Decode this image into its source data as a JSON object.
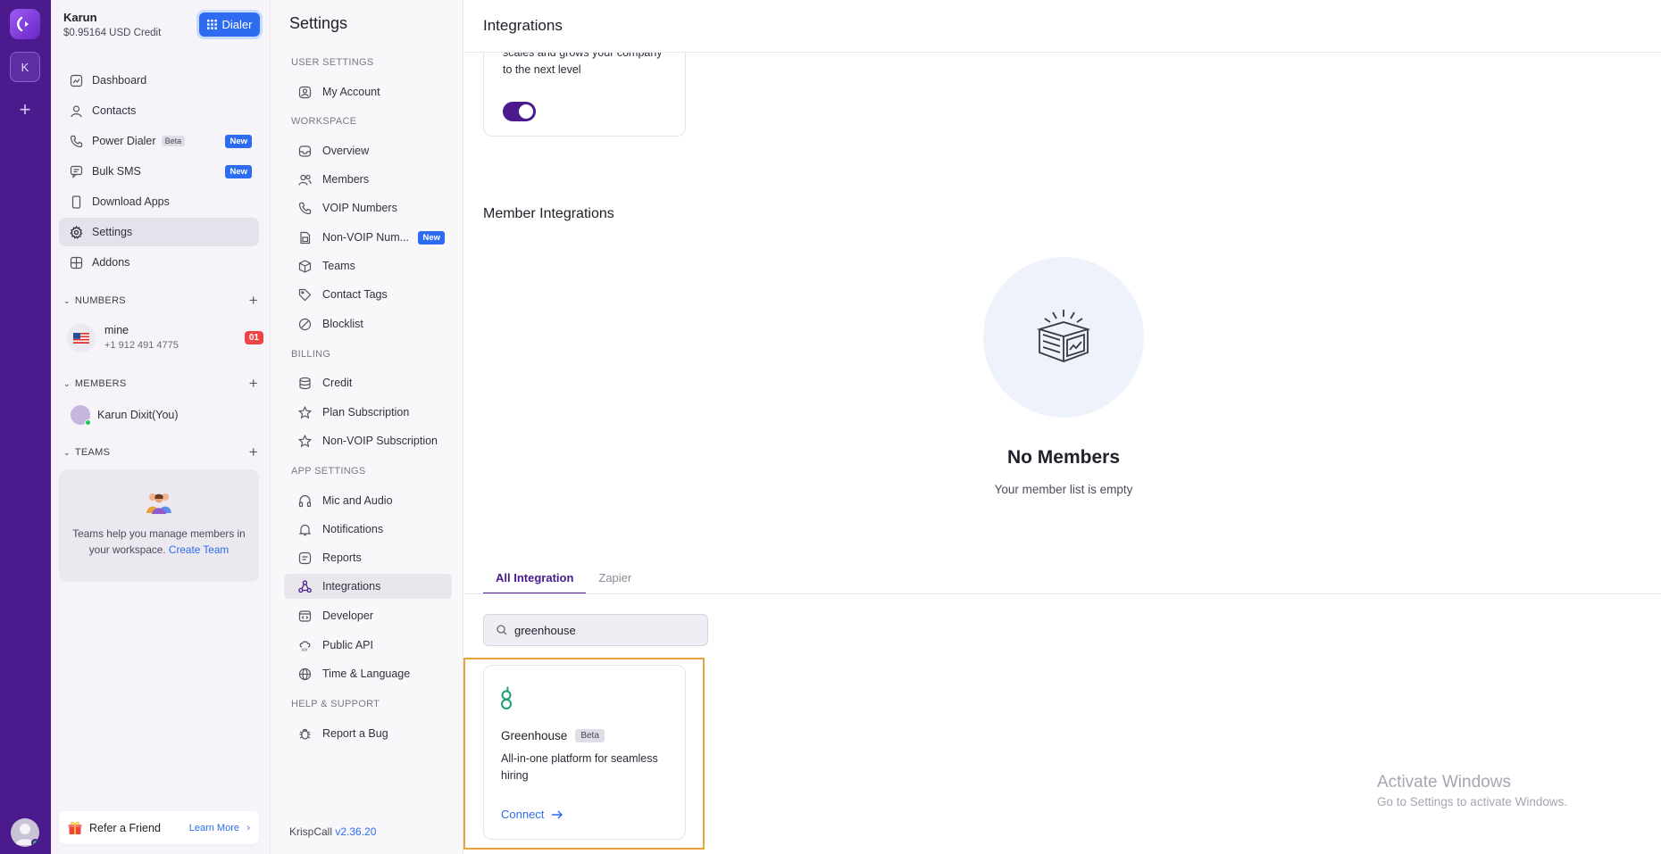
{
  "account": {
    "name": "Karun",
    "credit": "$0.95164 USD Credit",
    "dialer_label": "Dialer",
    "workspace_initial": "K"
  },
  "nav": [
    {
      "label": "Dashboard",
      "icon": "dashboard-icon"
    },
    {
      "label": "Contacts",
      "icon": "contacts-icon"
    },
    {
      "label": "Power Dialer",
      "icon": "phone-icon",
      "beta": "Beta",
      "badge": "New"
    },
    {
      "label": "Bulk SMS",
      "icon": "sms-icon",
      "badge": "New"
    },
    {
      "label": "Download Apps",
      "icon": "mobile-icon"
    },
    {
      "label": "Settings",
      "icon": "gear-icon",
      "active": true
    },
    {
      "label": "Addons",
      "icon": "addons-icon"
    }
  ],
  "numbers": {
    "heading": "NUMBERS",
    "name": "mine",
    "number": "+1 912 491 4775",
    "badge": "01"
  },
  "members": {
    "heading": "MEMBERS",
    "name": "Karun Dixit(You)"
  },
  "teams": {
    "heading": "TEAMS",
    "text": "Teams help you manage members in your workspace.",
    "link": "Create Team"
  },
  "refer": {
    "label": "Refer a Friend",
    "link": "Learn More"
  },
  "settings": {
    "title": "Settings",
    "sections": {
      "user": "USER SETTINGS",
      "workspace": "WORKSPACE",
      "billing": "BILLING",
      "app": "APP SETTINGS",
      "help": "HELP & SUPPORT"
    },
    "items": {
      "my_account": "My Account",
      "overview": "Overview",
      "members": "Members",
      "voip": "VOIP Numbers",
      "non_voip": "Non-VOIP Num...",
      "non_voip_badge": "New",
      "teams": "Teams",
      "contact_tags": "Contact Tags",
      "blocklist": "Blocklist",
      "credit": "Credit",
      "plan": "Plan Subscription",
      "non_voip_sub": "Non-VOIP Subscription",
      "mic": "Mic and Audio",
      "notifications": "Notifications",
      "reports": "Reports",
      "integrations": "Integrations",
      "developer": "Developer",
      "public_api": "Public API",
      "time_lang": "Time & Language",
      "bug": "Report a Bug"
    },
    "version_prefix": "KrispCall",
    "version": "v2.36.20"
  },
  "main": {
    "title": "Integrations",
    "top_card_desc": "scales and grows your company to the next level",
    "member_integrations": "Member Integrations",
    "empty_title": "No Members",
    "empty_sub": "Your member list is empty",
    "tabs": [
      "All Integration",
      "Zapier"
    ],
    "search_value": "greenhouse",
    "card": {
      "name": "Greenhouse",
      "beta": "Beta",
      "desc": "All-in-one platform for seamless hiring",
      "connect": "Connect"
    }
  },
  "watermark": {
    "line1": "Activate Windows",
    "line2": "Go to Settings to activate Windows."
  },
  "colors": {
    "brand": "#4b1a8c",
    "accent": "#2d6cf0",
    "highlight": "#e8a23a",
    "alert": "#ef4444"
  }
}
